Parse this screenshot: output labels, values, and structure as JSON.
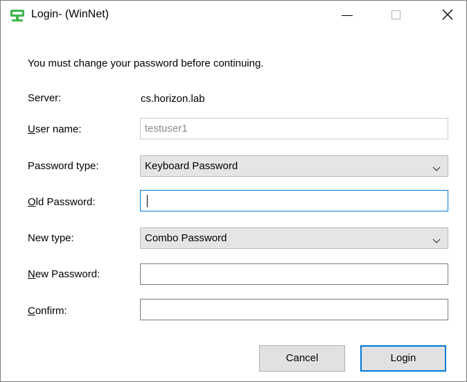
{
  "window": {
    "title": "Login- (WinNet)"
  },
  "message": "You must change your password before continuing.",
  "server": {
    "label": "Server:",
    "value": "cs.horizon.lab"
  },
  "user_name": {
    "label_access": "U",
    "label_rest": "ser name:",
    "value": "testuser1"
  },
  "password_type": {
    "label": "Password type:",
    "selected": "Keyboard Password"
  },
  "old_password": {
    "label_access": "O",
    "label_rest": "ld Password:",
    "value": ""
  },
  "new_type": {
    "label": "New type:",
    "selected": "Combo Password"
  },
  "new_password": {
    "label_access": "N",
    "label_rest": "ew Password:",
    "value": ""
  },
  "confirm": {
    "label_access": "C",
    "label_rest": "onfirm:",
    "value": ""
  },
  "buttons": {
    "cancel": "Cancel",
    "login": "Login"
  },
  "colors": {
    "accent": "#0078d7",
    "icon_green": "#3cb54a"
  },
  "icons": {
    "app": "monitor-icon",
    "minimize": "minimize-icon",
    "maximize": "maximize-icon",
    "close": "close-icon",
    "dropdown": "chevron-down-icon"
  }
}
